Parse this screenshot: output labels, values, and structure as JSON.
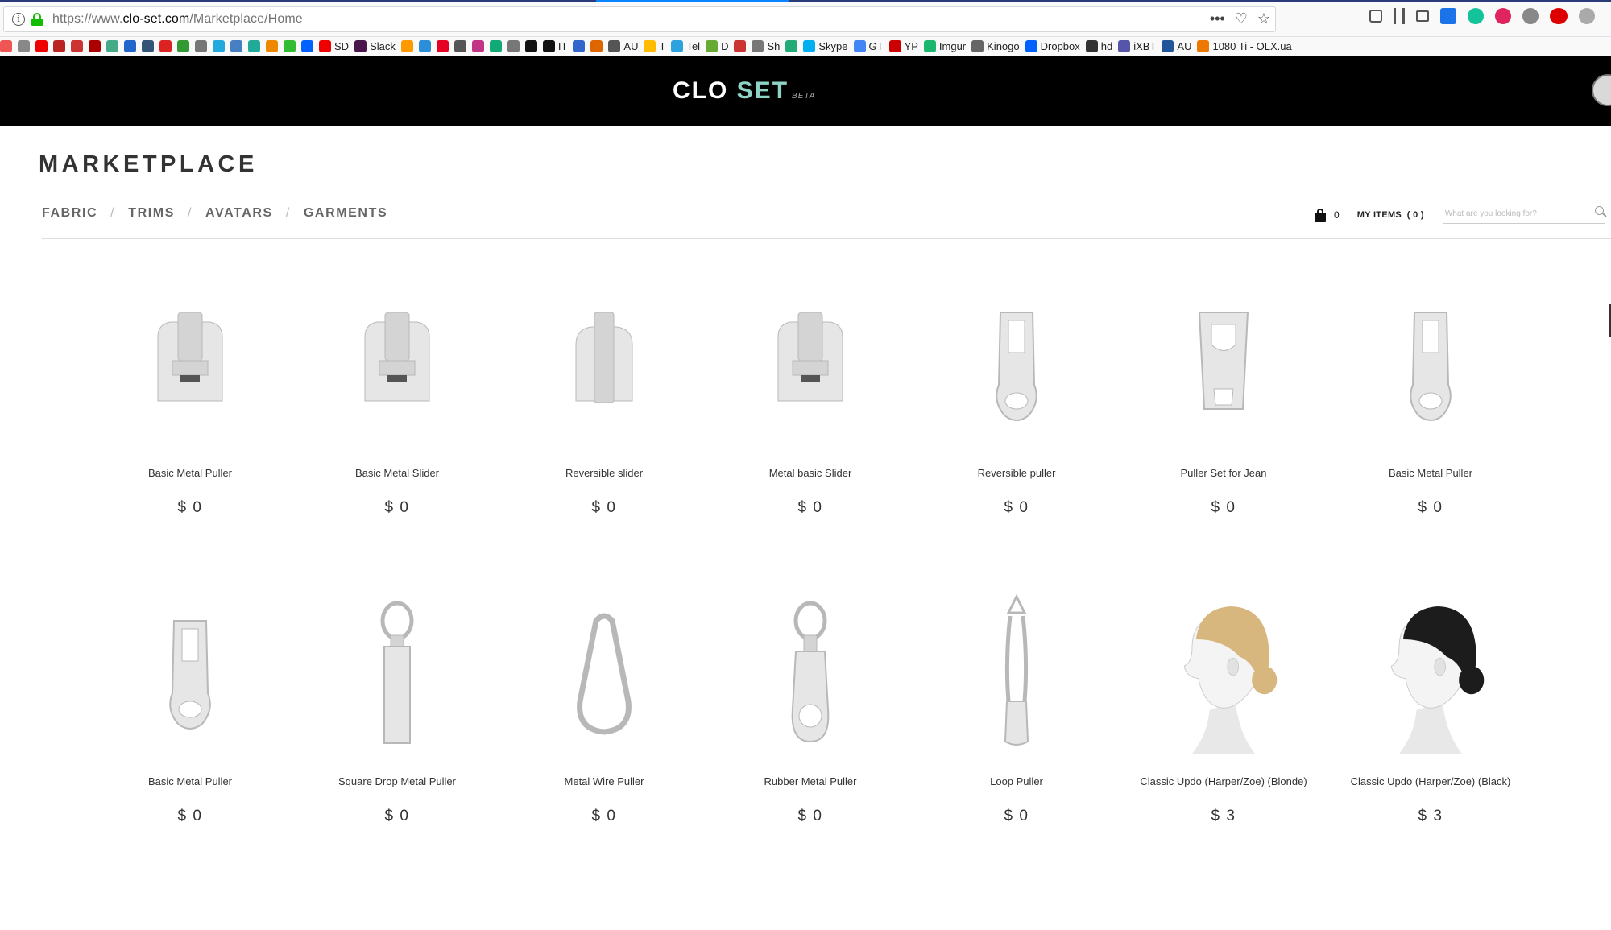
{
  "browser": {
    "url_prefix": "https://www.",
    "url_domain": "clo-set.com",
    "url_path": "/Marketplace/Home",
    "url_actions": [
      "•••",
      "♡",
      "☆"
    ],
    "bookmarks": [
      {
        "label": "",
        "color": "#e55"
      },
      {
        "label": "",
        "color": "#888"
      },
      {
        "label": "",
        "color": "#e00"
      },
      {
        "label": "",
        "color": "#b22"
      },
      {
        "label": "",
        "color": "#c33"
      },
      {
        "label": "",
        "color": "#a00"
      },
      {
        "label": "",
        "color": "#4a8"
      },
      {
        "label": "",
        "color": "#26c"
      },
      {
        "label": "",
        "color": "#357"
      },
      {
        "label": "",
        "color": "#d22"
      },
      {
        "label": "",
        "color": "#393"
      },
      {
        "label": "",
        "color": "#777"
      },
      {
        "label": "",
        "color": "#2ad"
      },
      {
        "label": "",
        "color": "#4680c2"
      },
      {
        "label": "",
        "color": "#2a9"
      },
      {
        "label": "",
        "color": "#e80"
      },
      {
        "label": "",
        "color": "#3b3"
      },
      {
        "label": "",
        "color": "#0061fe"
      },
      {
        "label": "SD",
        "color": "#e00"
      },
      {
        "label": "Slack",
        "color": "#4a154b"
      },
      {
        "label": "",
        "color": "#f90"
      },
      {
        "label": "",
        "color": "#2a8fd8"
      },
      {
        "label": "",
        "color": "#e60023"
      },
      {
        "label": "",
        "color": "#555"
      },
      {
        "label": "",
        "color": "#c13584"
      },
      {
        "label": "",
        "color": "#1a7"
      },
      {
        "label": "",
        "color": "#777"
      },
      {
        "label": "",
        "color": "#111"
      },
      {
        "label": "IT",
        "color": "#111"
      },
      {
        "label": "",
        "color": "#36c"
      },
      {
        "label": "",
        "color": "#d60"
      },
      {
        "label": "AU",
        "color": "#555"
      },
      {
        "label": "T",
        "color": "#fb0"
      },
      {
        "label": "Tel",
        "color": "#2aa3df"
      },
      {
        "label": "D",
        "color": "#6a3"
      },
      {
        "label": "",
        "color": "#c33"
      },
      {
        "label": "Sh",
        "color": "#777"
      },
      {
        "label": "",
        "color": "#2a7"
      },
      {
        "label": "Skype",
        "color": "#00aff0"
      },
      {
        "label": "GT",
        "color": "#4285f4"
      },
      {
        "label": "YP",
        "color": "#c00"
      },
      {
        "label": "Imgur",
        "color": "#1bb76e"
      },
      {
        "label": "Kinogo",
        "color": "#666"
      },
      {
        "label": "Dropbox",
        "color": "#0061fe"
      },
      {
        "label": "hd",
        "color": "#333"
      },
      {
        "label": "iXBT",
        "color": "#55a"
      },
      {
        "label": "AU",
        "color": "#259"
      },
      {
        "label": "1080 Ti - OLX.ua",
        "color": "#e70"
      }
    ]
  },
  "header": {
    "logo_main": "CLO ",
    "logo_accent": "SET",
    "logo_badge": "BETA"
  },
  "page": {
    "title": "MARKETPLACE",
    "categories": [
      "FABRIC",
      "TRIMS",
      "AVATARS",
      "GARMENTS"
    ],
    "separator": "/",
    "cart_count": "0",
    "my_items_label": "MY ITEMS",
    "my_items_count": "( 0 )",
    "search_placeholder": "What are you looking for?"
  },
  "products": [
    {
      "name": "Basic Metal Puller",
      "price": "$ 0",
      "icon": "slider-icon"
    },
    {
      "name": "Basic Metal Slider",
      "price": "$ 0",
      "icon": "slider-icon"
    },
    {
      "name": "Reversible slider",
      "price": "$ 0",
      "icon": "reversible-slider-icon"
    },
    {
      "name": "Metal basic Slider",
      "price": "$ 0",
      "icon": "slider-icon"
    },
    {
      "name": "Reversible puller",
      "price": "$ 0",
      "icon": "puller-icon"
    },
    {
      "name": "Puller Set for Jean",
      "price": "$ 0",
      "icon": "jean-puller-icon"
    },
    {
      "name": "Basic Metal Puller",
      "price": "$ 0",
      "icon": "puller-icon"
    },
    {
      "name": "Basic Metal Puller",
      "price": "$ 0",
      "icon": "puller-icon"
    },
    {
      "name": "Square Drop Metal Puller",
      "price": "$ 0",
      "icon": "drop-puller-icon"
    },
    {
      "name": "Metal Wire Puller",
      "price": "$ 0",
      "icon": "wire-puller-icon"
    },
    {
      "name": "Rubber Metal Puller",
      "price": "$ 0",
      "icon": "rubber-puller-icon"
    },
    {
      "name": "Loop Puller",
      "price": "$ 0",
      "icon": "loop-puller-icon"
    },
    {
      "name": "Classic Updo (Harper/Zoe) (Blonde)",
      "price": "$ 3",
      "icon": "avatar-head-blonde-icon",
      "hair_color": "#d8b77e"
    },
    {
      "name": "Classic Updo (Harper/Zoe) (Black)",
      "price": "$ 3",
      "icon": "avatar-head-black-icon",
      "hair_color": "#1c1c1c"
    }
  ]
}
